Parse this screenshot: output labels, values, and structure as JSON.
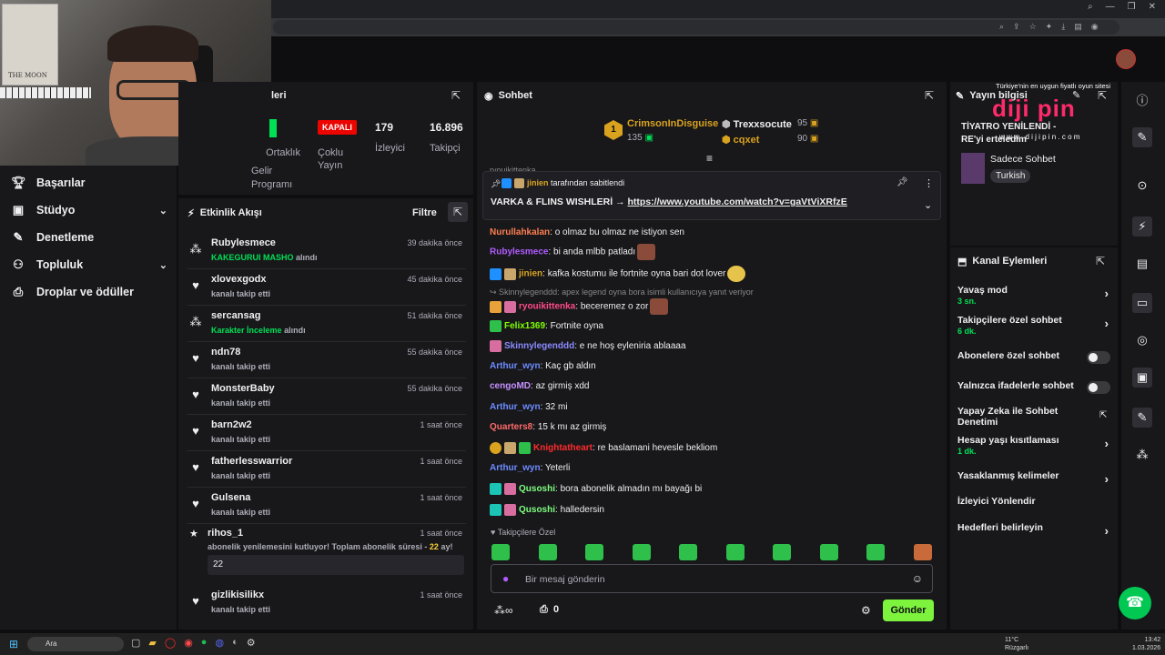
{
  "overlay": {
    "tagline": "Türkiye'nin en uygun fiyatlı oyun sitesi",
    "logo_text": "diji pin",
    "logo_url": "w w w . d i j i p i n . c o m"
  },
  "leftnav": {
    "items": [
      {
        "label": "Başarılar",
        "icon": "trophy-icon"
      },
      {
        "label": "Stüdyo",
        "icon": "video-icon",
        "chevron": true
      },
      {
        "label": "Denetleme",
        "icon": "wrench-icon"
      },
      {
        "label": "Topluluk",
        "icon": "people-icon",
        "chevron": true
      },
      {
        "label": "Droplar ve ödüller",
        "icon": "gift-icon"
      }
    ]
  },
  "stats": {
    "title_partial": "leri",
    "partner_label": "Ortaklık",
    "partner_sub": "Gelir",
    "partner_sub2": "Programı",
    "kapali": "KAPALI",
    "coklu_label": "Çoklu Yayın",
    "viewers": "179",
    "viewers_label": "İzleyici",
    "followers": "16.896",
    "followers_label": "Takipçi"
  },
  "activity": {
    "title": "Etkinlik Akışı",
    "filter": "Filtre",
    "rows": [
      {
        "icon": "points",
        "name": "Rubylesmece",
        "reward": "KAKEGURUI MASHO",
        "sub": "alındı",
        "time": "39 dakika önce"
      },
      {
        "icon": "heart",
        "name": "xlovexgodx",
        "sub": "kanalı takip etti",
        "time": "45 dakika önce"
      },
      {
        "icon": "points",
        "name": "sercansag",
        "reward": "Karakter İnceleme",
        "sub": "alındı",
        "time": "51 dakika önce"
      },
      {
        "icon": "heart",
        "name": "ndn78",
        "sub": "kanalı takip etti",
        "time": "55 dakika önce"
      },
      {
        "icon": "heart",
        "name": "MonsterBaby",
        "sub": "kanalı takip etti",
        "time": "55 dakika önce"
      },
      {
        "icon": "heart",
        "name": "barn2w2",
        "sub": "kanalı takip etti",
        "time": "1 saat önce"
      },
      {
        "icon": "heart",
        "name": "fatherlesswarrior",
        "sub": "kanalı takip etti",
        "time": "1 saat önce"
      },
      {
        "icon": "heart",
        "name": "Gulsena",
        "sub": "kanalı takip etti",
        "time": "1 saat önce"
      }
    ],
    "resub": {
      "name": "rihos_1",
      "text_a": "abonelik yenilemesini kutluyor! Toplam abonelik süresi -",
      "months": "22",
      "text_b": "ay!",
      "message": "22",
      "time": "1 saat önce"
    },
    "last": {
      "name": "gizlikisilikx",
      "sub": "kanalı takip etti",
      "time": "1 saat önce"
    }
  },
  "chat": {
    "title": "Sohbet",
    "leaderboard": [
      {
        "rank": "1",
        "name": "CrimsonInDisguise",
        "value": "135"
      },
      {
        "rank": "2",
        "name": "Trexxsocute",
        "value": "95"
      },
      {
        "rank": "3",
        "name": "cqxet",
        "value": "90"
      }
    ],
    "partial_user": "ryouikittenka",
    "pinned": {
      "by": "jinien",
      "by_text": "tarafından sabitlendi",
      "text": "VARKA & FLINS WISHLERİ →",
      "link": "https://www.youtube.com/watch?v=gaVtViXRfzE"
    },
    "messages": [
      {
        "user": "Nurullahkalan",
        "color": "#ff7f50",
        "text": "o olmaz bu olmaz ne istiyon sen"
      },
      {
        "user": "Rubylesmece",
        "color": "#b05cff",
        "text": "bi anda mlbb patladı"
      },
      {
        "user": "jinien",
        "color": "#daa520",
        "text": "kafka kostumu ile fortnite oyna bari dot lover"
      },
      {
        "reply": "Skinnylegenddd: apex legend oyna bora isimli kullanıcıya yanıt veriyor"
      },
      {
        "user": "ryouikittenka",
        "color": "#ff4a8a",
        "text": "beceremez o zor"
      },
      {
        "user": "Felix1369",
        "color": "#7fff00",
        "text": "Fortnite oyna"
      },
      {
        "user": "Skinnylegenddd",
        "color": "#8a8aff",
        "text": "e ne hoş eyleniria ablaaaa"
      },
      {
        "user": "Arthur_wyn",
        "color": "#6c8cff",
        "text": "Kaç gb aldın"
      },
      {
        "user": "cengoMD",
        "color": "#c790ff",
        "text": "az girmiş xdd"
      },
      {
        "user": "Arthur_wyn",
        "color": "#6c8cff",
        "text": "32 mi"
      },
      {
        "user": "Quarters8",
        "color": "#ff6a6a",
        "text": "15 k mı az girmiş"
      },
      {
        "user": "Knightatheart",
        "color": "#ff2a2a",
        "text": "re baslamani hevesle bekliom"
      },
      {
        "user": "Arthur_wyn",
        "color": "#6c8cff",
        "text": "Yeterli"
      },
      {
        "user": "Qusoshi",
        "color": "#7fff7f",
        "text": "bora abonelik almadın mı bayağı bi"
      },
      {
        "user": "Qusoshi",
        "color": "#7fff7f",
        "text": "halledersin"
      }
    ],
    "followers_only": "Takipçilere Özel",
    "placeholder": "Bir mesaj gönderin",
    "points": "0",
    "send": "Gönder"
  },
  "info": {
    "title": "Yayın bilgisi",
    "stream_title": "TİYATRO YENİLENDİ - RE'yi erteledim",
    "category": "Sadece Sohbet",
    "tag": "Turkish"
  },
  "actions": {
    "title": "Kanal Eylemleri",
    "items": [
      {
        "label": "Yavaş mod",
        "value": "3 sn.",
        "type": "chevron"
      },
      {
        "label": "Takipçilere özel sohbet",
        "value": "6 dk.",
        "type": "chevron"
      },
      {
        "label": "Abonelere özel sohbet",
        "type": "toggle"
      },
      {
        "label": "Yalnızca ifadelerle sohbet",
        "type": "toggle"
      },
      {
        "label": "Yapay Zeka ile Sohbet Denetimi",
        "type": "external"
      },
      {
        "label": "Hesap yaşı kısıtlaması",
        "value": "1 dk.",
        "type": "chevron"
      },
      {
        "label": "Yasaklanmış kelimeler",
        "type": "chevron"
      },
      {
        "label": "İzleyici Yönlendir",
        "type": "none"
      },
      {
        "label": "Hedefleri belirleyin",
        "type": "chevron"
      }
    ]
  },
  "taskbar": {
    "search": "Ara",
    "temp": "11°C",
    "weather": "Rüzgarlı",
    "time": "13:42",
    "date": "1.03.2026"
  }
}
